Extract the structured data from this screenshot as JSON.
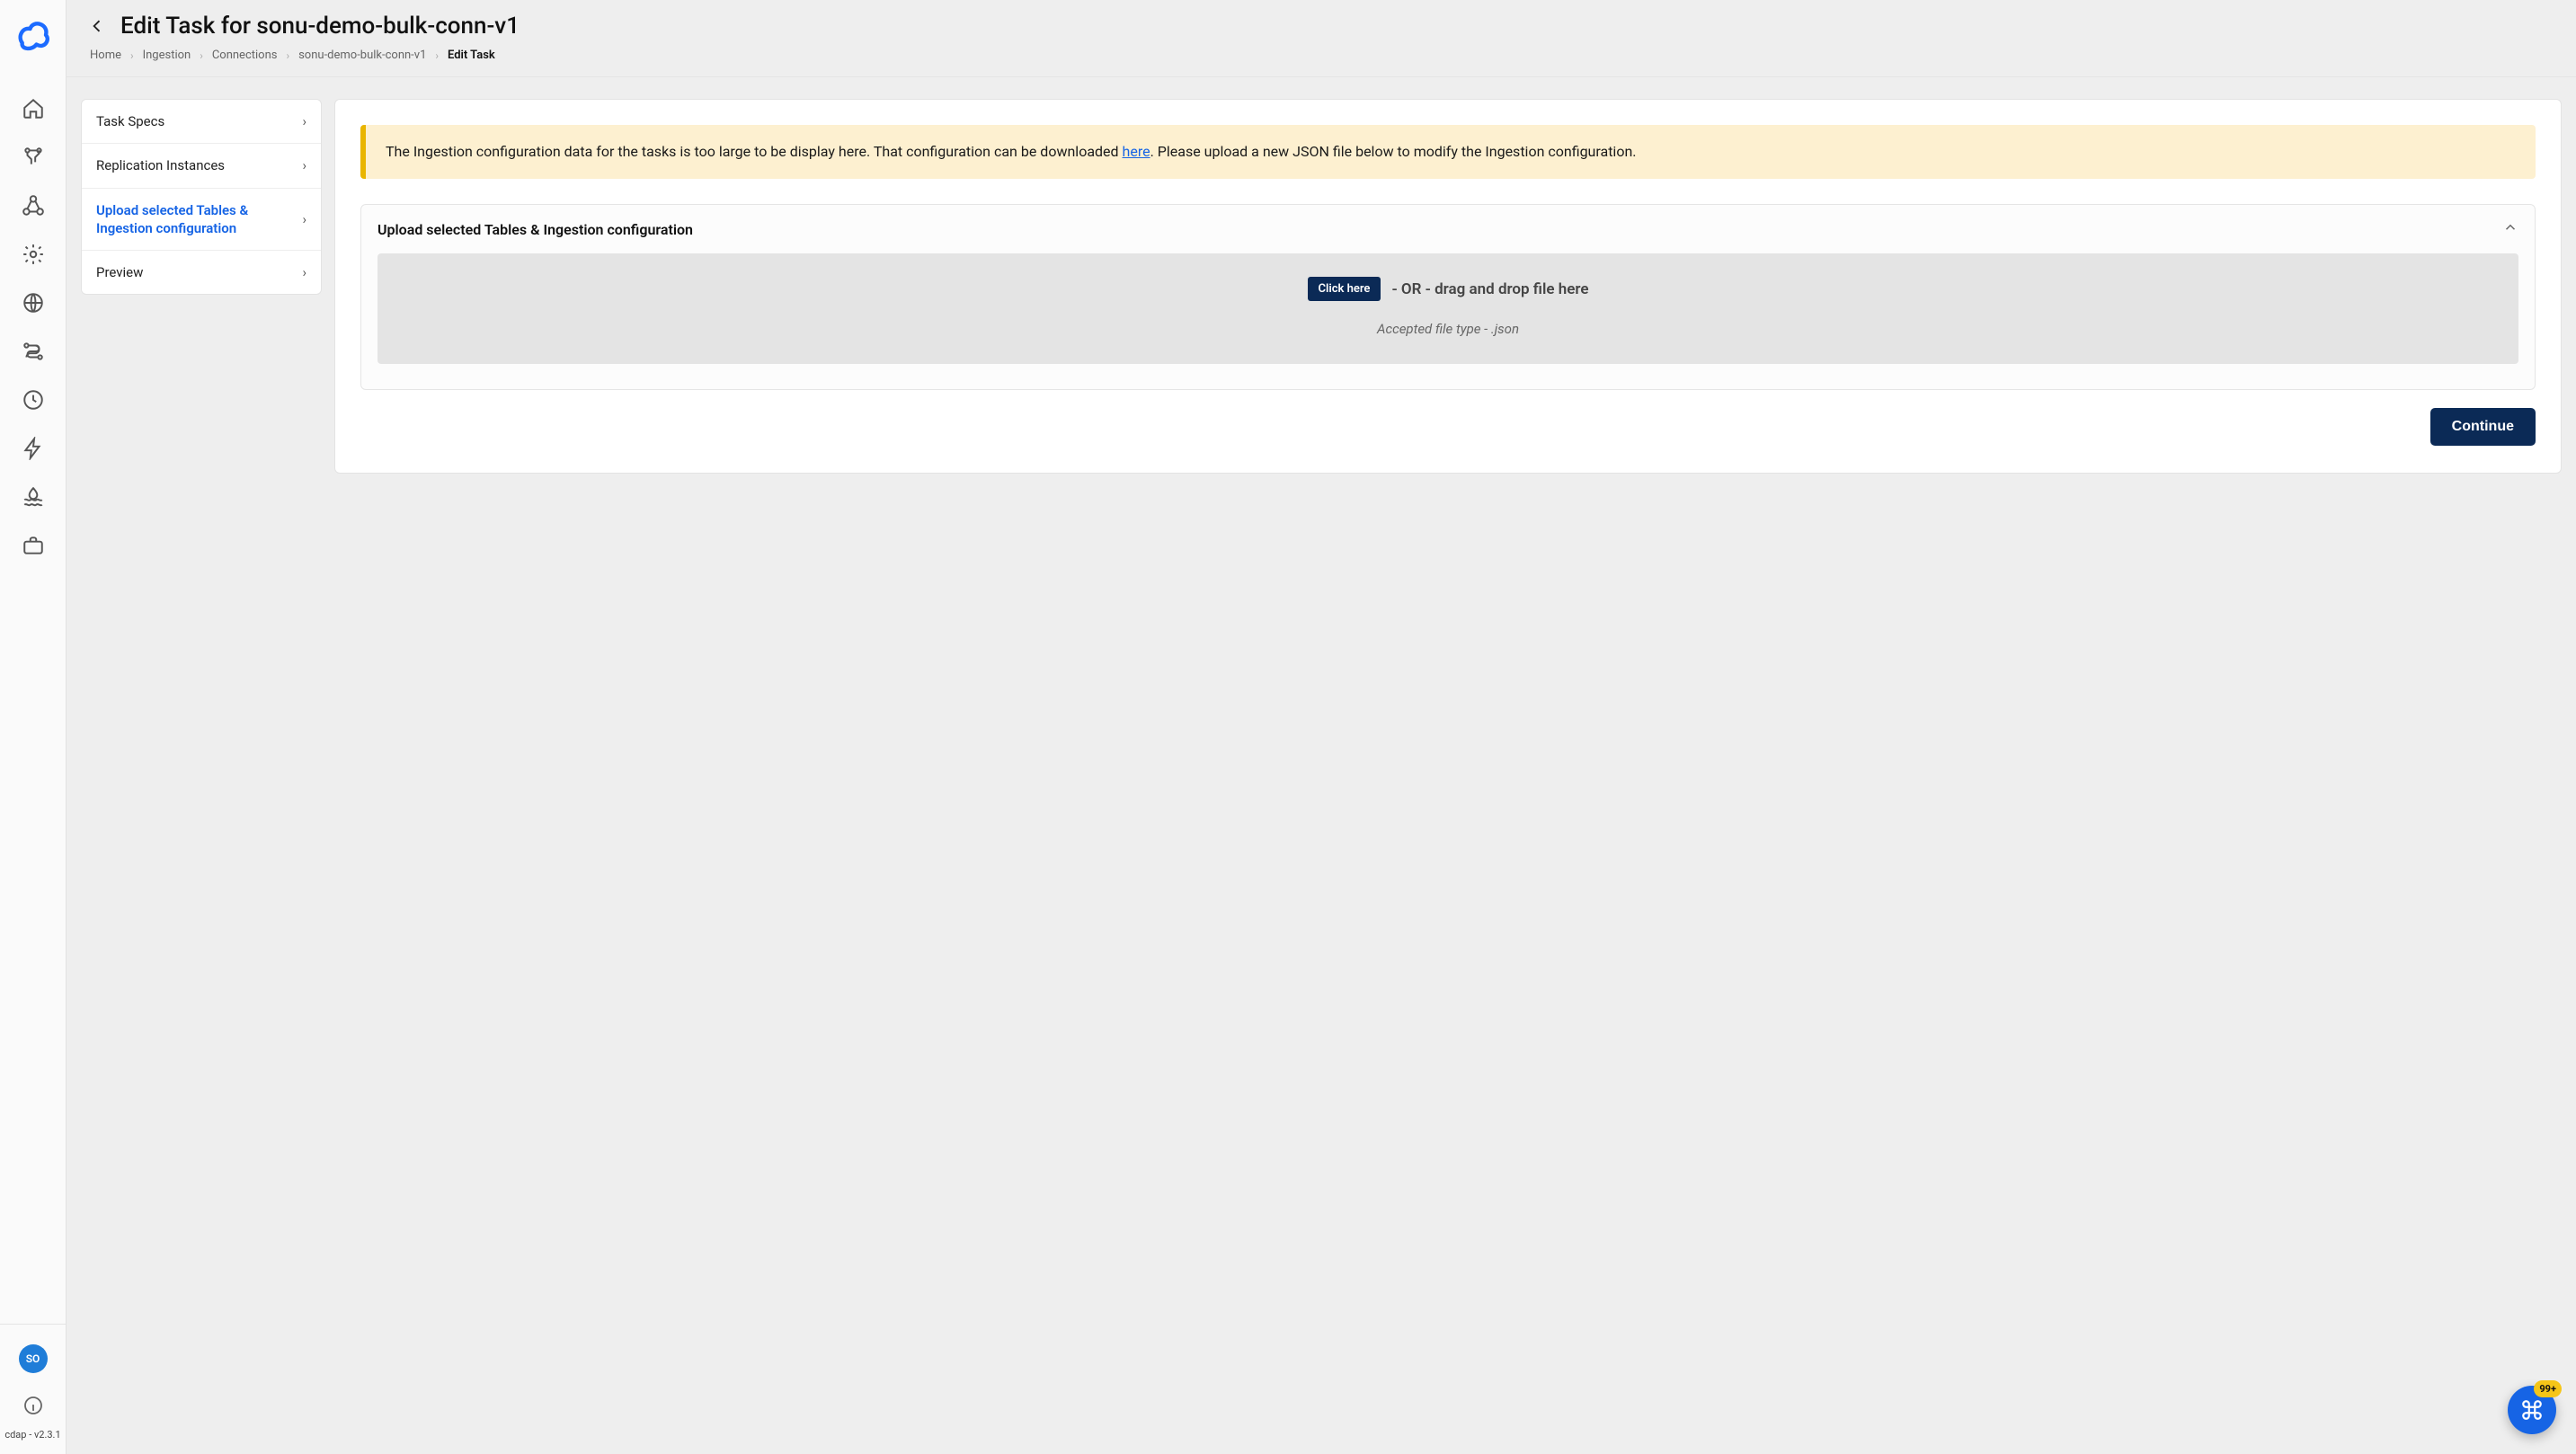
{
  "header": {
    "title": "Edit Task for sonu-demo-bulk-conn-v1",
    "breadcrumbs": [
      "Home",
      "Ingestion",
      "Connections",
      "sonu-demo-bulk-conn-v1",
      "Edit Task"
    ]
  },
  "steps": [
    {
      "label": "Task Specs",
      "active": false
    },
    {
      "label": "Replication Instances",
      "active": false
    },
    {
      "label": "Upload selected Tables & Ingestion configuration",
      "active": true
    },
    {
      "label": "Preview",
      "active": false
    }
  ],
  "alert": {
    "text_before_link": "The Ingestion configuration data for the tasks is too large to be display here. That configuration can be downloaded ",
    "link_text": "here",
    "text_after_link": ". Please upload a new JSON file below to modify the Ingestion configuration."
  },
  "panel": {
    "title": "Upload selected Tables & Ingestion configuration",
    "click_here": "Click here",
    "dz_text": " - OR - drag and drop file here",
    "dz_sub": "Accepted file type - .json"
  },
  "actions": {
    "continue": "Continue"
  },
  "rail": {
    "avatar": "SO",
    "version": "cdap - v2.3.1",
    "icons": [
      "home",
      "filter",
      "nodes",
      "settings",
      "globe",
      "route",
      "clock",
      "bolt",
      "water",
      "briefcase"
    ]
  },
  "fab": {
    "badge": "99+"
  }
}
